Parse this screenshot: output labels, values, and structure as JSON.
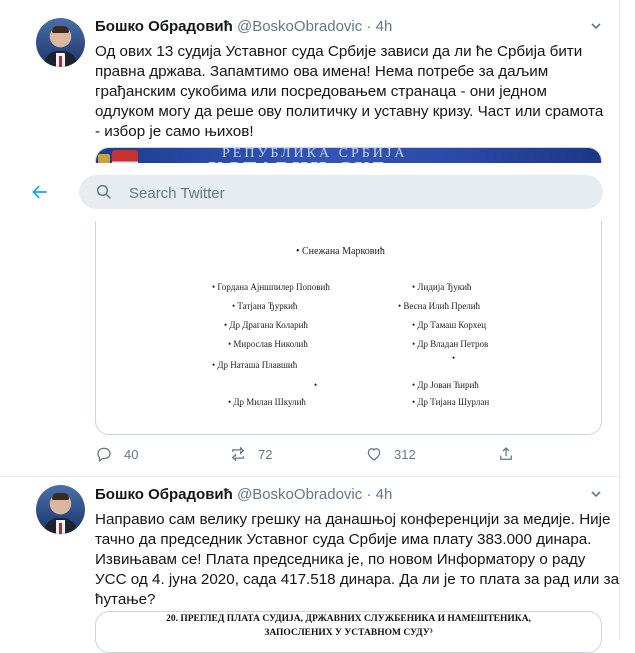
{
  "tweets": [
    {
      "name": "Бошко Обрадовић",
      "handle": "@BoskoObradovic",
      "sep": "·",
      "time": "4h",
      "text_lines": [
        "Од ових 13 судија Уставног суда Србије зависи да ли ће Србија бити",
        "правна држава. Запамтимо ова имена! Нема потребе за даљим",
        "грађанским сукобима или посредовањем странаца - они  једном",
        "одлуком могу да реше ову политичку и уставну кризу. Част или срамота",
        "- избор је само њихов!"
      ],
      "image": {
        "banner_top": "РЕПУБЛИКА   СРБИЈА",
        "banner_big": "УСТАВНИ  СУД",
        "judges": [
          "Снежана Марковић",
          "Гордана Ајншпилер Поповић",
          "Татјана Ђуркић",
          "Др Драгана Коларић",
          "Мирослав Николић",
          "Др Наташа Плавшић",
          "Др Милан Шкулић",
          "Лидија Ђукић",
          "Весна Илић Прелић",
          "Др Тамаш Корхец",
          "Др Владан Петров",
          "Др Јован Ћирић",
          "Др Тијана Шурлан"
        ]
      },
      "replies": "40",
      "retweets": "72",
      "likes": "312"
    },
    {
      "name": "Бошко Обрадовић",
      "handle": "@BoskoObradovic",
      "sep": "·",
      "time": "4h",
      "text_lines": [
        "Направио сам велику грешку на данашњој конференцији за медије. Није",
        "тачно да председник Уставног суда Србије има плату 383.000 динара.",
        "Извињавам се! Плата председника је, по новом Информатору о раду",
        "УСС од 4. јуна 2020, сада 417.518 динара. Да ли је то плата за рад или за",
        "ћутање?"
      ],
      "image": {
        "line1": "20. ПРЕГЛЕД ПЛАТА СУДИЈА, ДРЖАВНИХ СЛУЖБЕНИКА И НАМЕШТЕНИКА,",
        "line2": "ЗАПОСЛЕНИХ  У УСТАВНОМ СУДУ³"
      }
    }
  ],
  "search": {
    "placeholder": "Search Twitter"
  },
  "icons": {
    "back": "arrow-left-icon",
    "search": "search-icon",
    "caret": "chevron-down-icon",
    "reply": "reply-icon",
    "retweet": "retweet-icon",
    "like": "heart-icon"
  },
  "colors": {
    "accent": "#1da1f2",
    "secondary_text": "#657786",
    "border": "#e6ecf0"
  }
}
